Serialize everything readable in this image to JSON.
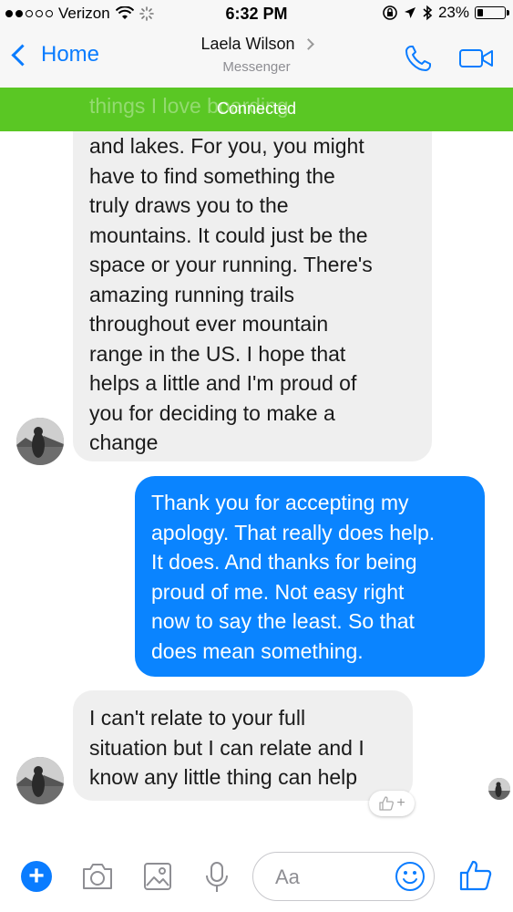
{
  "status_bar": {
    "carrier": "Verizon",
    "time": "6:32 PM",
    "battery": "23%",
    "battery_level": 0.23
  },
  "nav": {
    "back_label": "Home",
    "contact_name": "Laela Wilson",
    "subtitle": "Messenger",
    "icons": [
      "phone-icon",
      "video-call-icon"
    ]
  },
  "banner": {
    "text": "Connected",
    "obscured_text": "things I love boarding",
    "color": "#5ac724"
  },
  "messages": [
    {
      "direction": "incoming",
      "text": "and lakes. For you, you might\nhave to find something the\ntruly draws you to the\nmountains. It could just be the\nspace or your running. There's\namazing running trails\nthroughout ever mountain\nrange in the US. I hope that\nhelps a little and I'm proud of\nyou for deciding to make a\nchange"
    },
    {
      "direction": "outgoing",
      "text": "Thank you for accepting my\napology. That really does help.\nIt does. And thanks for being\nproud of me. Not easy right\nnow to say the least. So that\ndoes mean something."
    },
    {
      "direction": "incoming",
      "text": "I can't relate to your full\nsituation but I can relate and I\nknow any little thing can help"
    }
  ],
  "reaction_button": "+",
  "composer": {
    "placeholder": "Aa",
    "icons": [
      "plus-icon",
      "camera-icon",
      "gallery-icon",
      "microphone-icon",
      "emoji-icon",
      "like-icon"
    ]
  },
  "colors": {
    "accent": "#0a7cff",
    "outgoing_bubble": "#0a84ff",
    "incoming_bubble": "#efefef"
  }
}
